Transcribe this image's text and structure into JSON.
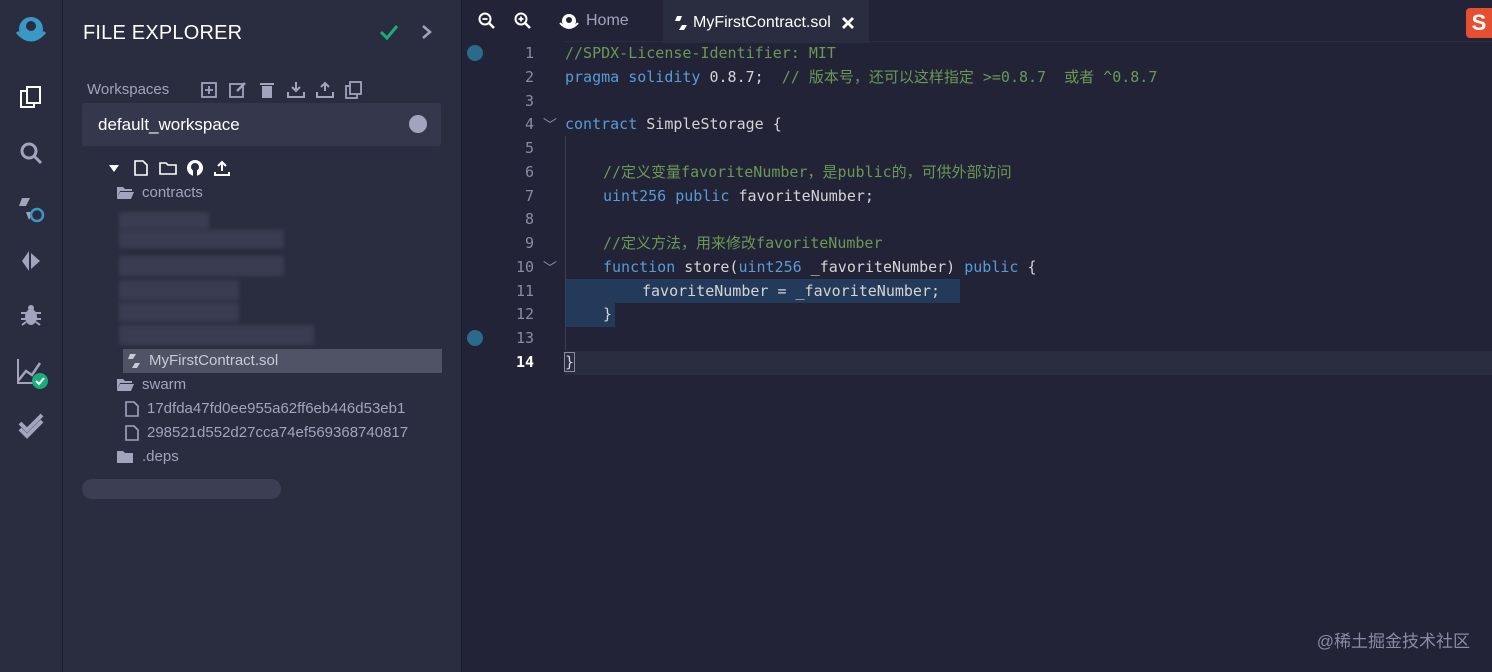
{
  "sidebar_icons": [
    "remix-logo-icon",
    "file-explorer-icon",
    "search-icon",
    "solidity-compiler-icon",
    "deploy-run-icon",
    "debugger-icon",
    "analysis-icon",
    "test-icon"
  ],
  "explorer": {
    "title": "FILE EXPLORER",
    "workspaces_label": "Workspaces",
    "workspace_value": "default_workspace",
    "tree": {
      "contracts_folder": "contracts",
      "selected_file": "MyFirstContract.sol",
      "swarm_folder": "swarm",
      "swarm_file_1": "17dfda47fd0ee955a62ff6eb446d53eb1",
      "swarm_file_2": "298521d552d27cca74ef569368740817",
      "deps_folder": ".deps"
    }
  },
  "tabs": {
    "home": "Home",
    "file": "MyFirstContract.sol"
  },
  "editor": {
    "line_numbers": [
      "1",
      "2",
      "3",
      "4",
      "5",
      "6",
      "7",
      "8",
      "9",
      "10",
      "11",
      "12",
      "13",
      "14"
    ],
    "active_line": "14",
    "lines": {
      "l1": "//SPDX-License-Identifier: MIT",
      "l2_kw1": "pragma",
      "l2_kw2": "solidity",
      "l2_ver": " 0.8.7;",
      "l2_comment": "  // 版本号，还可以这样指定 >=0.8.7  或者 ^0.8.7",
      "l4_kw": "contract",
      "l4_name": " SimpleStorage {",
      "l6": "//定义变量favoriteNumber，是public的，可供外部访问",
      "l7_type": "uint256",
      "l7_pub": " public",
      "l7_name": " favoriteNumber;",
      "l9": "//定义方法，用来修改favoriteNumber",
      "l10_fn": "function",
      "l10_a": " store(",
      "l10_type": "uint256",
      "l10_b": " _favoriteNumber) ",
      "l10_pub": "public",
      "l10_c": " {",
      "l11": "favoriteNumber = _favoriteNumber;",
      "l12": "}",
      "l14": "}"
    }
  },
  "watermark": "@稀土掘金技术社区",
  "colors": {
    "background": "#222336",
    "panel": "#2a2c3f",
    "keyword": "#569cd6",
    "comment": "#6a9955",
    "success": "#1aad7a"
  }
}
